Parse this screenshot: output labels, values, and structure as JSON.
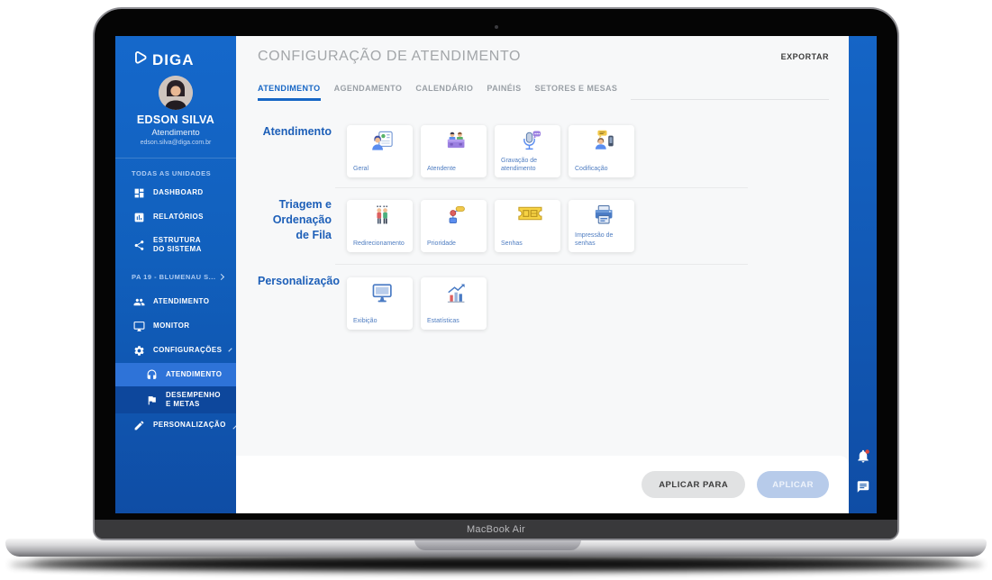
{
  "device": {
    "label": "MacBook Air"
  },
  "colors": {
    "accent": "#1565c0",
    "sidebar_top": "#1568cb",
    "sidebar_bottom": "#0f4da5",
    "submenu_active_bg": "#2e73d8",
    "submenu_dark_bg": "#0d479c",
    "notification_badge": "#e0483e",
    "apply_to_button_bg": "#e1e2e3",
    "apply_button_bg": "#b7cbea",
    "ticket_yellow": "#f5c842"
  },
  "sidebar": {
    "logo_text": "DIGA",
    "user": {
      "name": "EDSON SILVA",
      "role": "Atendimento",
      "email": "edson.silva@diga.com.br"
    },
    "section_all_units": "TODAS AS UNIDADES",
    "nav_global": [
      {
        "label": "DASHBOARD",
        "icon": "dashboard-icon"
      },
      {
        "label": "RELATÓRIOS",
        "icon": "reports-icon"
      },
      {
        "label": "ESTRUTURA DO SISTEMA",
        "icon": "share-icon"
      }
    ],
    "unit_section": "PA 19 - BLUMENAU S...",
    "nav_unit": [
      {
        "label": "ATENDIMENTO",
        "icon": "people-icon"
      },
      {
        "label": "MONITOR",
        "icon": "monitor-icon"
      },
      {
        "label": "CONFIGURAÇÕES",
        "icon": "gear-icon",
        "expanded": true
      }
    ],
    "nav_sub": [
      {
        "label": "ATENDIMENTO",
        "icon": "headset-icon",
        "active": true
      },
      {
        "label": "DESEMPENHO E METAS",
        "icon": "flag-icon",
        "active": false
      }
    ],
    "nav_personalization": {
      "label": "PERSONALIZAÇÃO",
      "icon": "pencil-icon",
      "expanded": false
    }
  },
  "header": {
    "title": "CONFIGURAÇÃO DE ATENDIMENTO",
    "export_label": "EXPORTAR"
  },
  "main": {
    "tabs": [
      "ATENDIMENTO",
      "AGENDAMENTO",
      "CALENDÁRIO",
      "PAINÉIS",
      "SETORES E MESAS"
    ],
    "active_tab": "ATENDIMENTO",
    "sections": [
      {
        "label": "Atendimento",
        "cards": [
          {
            "label": "Geral",
            "icon": "person-document-icon"
          },
          {
            "label": "Atendente",
            "icon": "reception-desk-icon"
          },
          {
            "label": "Gravação de atendimento",
            "icon": "microphone-chat-icon"
          },
          {
            "label": "Codificação",
            "icon": "person-devices-icon"
          }
        ]
      },
      {
        "label": "Triagem e Ordenação de Fila",
        "cards": [
          {
            "label": "Redirecionamento",
            "icon": "two-people-icon"
          },
          {
            "label": "Prioridade",
            "icon": "flowchart-icon"
          },
          {
            "label": "Senhas",
            "icon": "ticket-icon"
          },
          {
            "label": "Impressão de senhas",
            "icon": "printer-icon"
          }
        ]
      },
      {
        "label": "Personalização",
        "cards": [
          {
            "label": "Exibição",
            "icon": "display-monitor-icon"
          },
          {
            "label": "Estatísticas",
            "icon": "statistics-chart-icon"
          }
        ]
      }
    ]
  },
  "footer": {
    "apply_to_label": "APLICAR PARA",
    "apply_label": "APLICAR"
  }
}
